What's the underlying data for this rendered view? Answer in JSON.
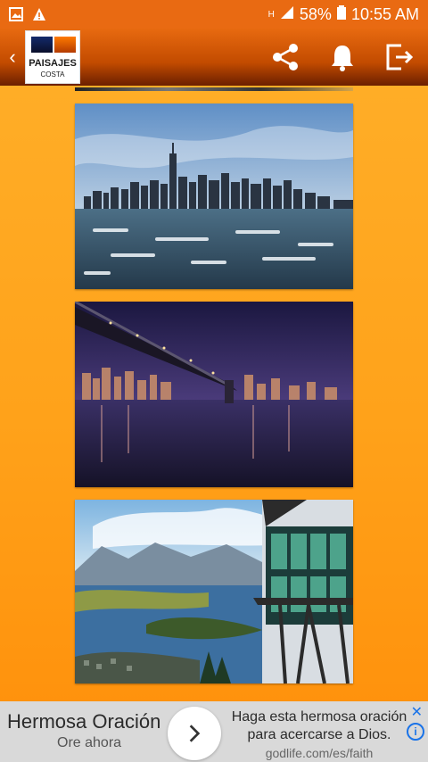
{
  "status_bar": {
    "left_icons": [
      "image-icon",
      "warning-icon"
    ],
    "network": "H",
    "battery": "58%",
    "time": "10:55 AM"
  },
  "app_bar": {
    "logo_line1": "PAISAJES",
    "logo_line2": "COSTA",
    "actions": [
      "share-icon",
      "bell-icon",
      "exit-icon"
    ]
  },
  "gallery": {
    "images": [
      {
        "name": "city-skyline-ice"
      },
      {
        "name": "bridge-night"
      },
      {
        "name": "lake-mountain-view"
      }
    ]
  },
  "ad": {
    "title": "Hermosa Oración",
    "subtitle": "Ore ahora",
    "text_line1": "Haga esta hermosa oración",
    "text_line2": "para acercarse a Dios.",
    "url": "godlife.com/es/faith",
    "close_icon": "close-icon",
    "info_icon": "info-icon"
  },
  "colors": {
    "status_bar": "#e96a12",
    "app_bar": "#c24b00",
    "background": "#ffa21a",
    "ad_background": "#d9d9d9"
  }
}
